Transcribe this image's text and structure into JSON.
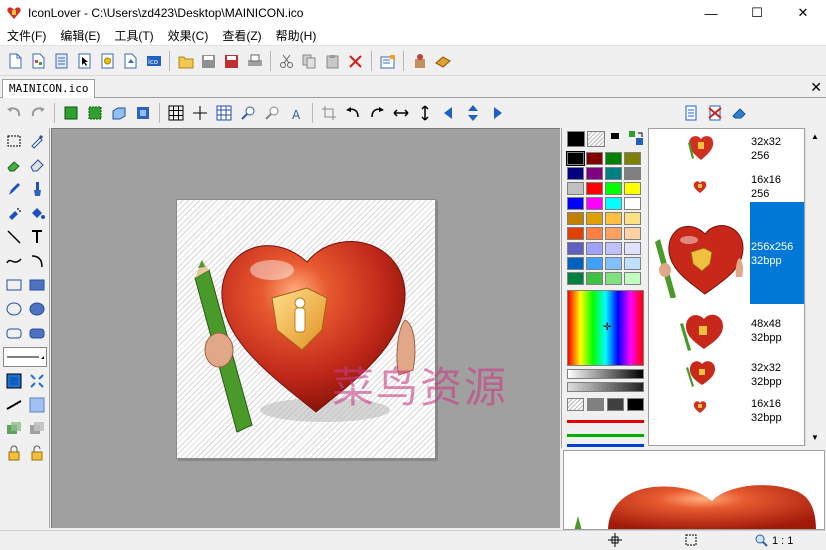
{
  "window": {
    "title": "IconLover - C:\\Users\\zd423\\Desktop\\MAINICON.ico",
    "minimize": "—",
    "maximize": "☐",
    "close": "✕"
  },
  "menu": [
    "文件(F)",
    "编辑(E)",
    "工具(T)",
    "效果(C)",
    "查看(Z)",
    "帮助(H)"
  ],
  "document_tab": {
    "label": "MAINICON.ico",
    "close": "✕"
  },
  "watermark": "菜鸟资源",
  "formats": [
    {
      "size": "32x32",
      "depth": "256"
    },
    {
      "size": "16x16",
      "depth": "256"
    },
    {
      "size": "256x256",
      "depth": "32bpp",
      "selected": true
    },
    {
      "size": "48x48",
      "depth": "32bpp"
    },
    {
      "size": "32x32",
      "depth": "32bpp"
    },
    {
      "size": "16x16",
      "depth": "32bpp"
    }
  ],
  "status": {
    "zoom": "1 : 1"
  },
  "colors": {
    "selection": "#0078d7",
    "canvas_bg": "#a0a0a0",
    "heart": "#c8281a",
    "pencil": "#4a9a2a"
  },
  "palette_swatches": [
    "#000000",
    "#800000",
    "#008000",
    "#808000",
    "#000080",
    "#800080",
    "#008080",
    "#808080",
    "#c0c0c0",
    "#ff0000",
    "#00ff00",
    "#ffff00",
    "#0000ff",
    "#ff00ff",
    "#00ffff",
    "#ffffff",
    "#c08000",
    "#e0a000",
    "#ffc040",
    "#ffe080",
    "#e04000",
    "#ff8040",
    "#ffa060",
    "#ffd0a0",
    "#6060c0",
    "#a0a0ff",
    "#c0c0ff",
    "#e0e0ff",
    "#0060c0",
    "#40a0ff",
    "#80c0ff",
    "#c0e0ff",
    "#008040",
    "#40c040",
    "#80e080",
    "#c0ffc0"
  ]
}
